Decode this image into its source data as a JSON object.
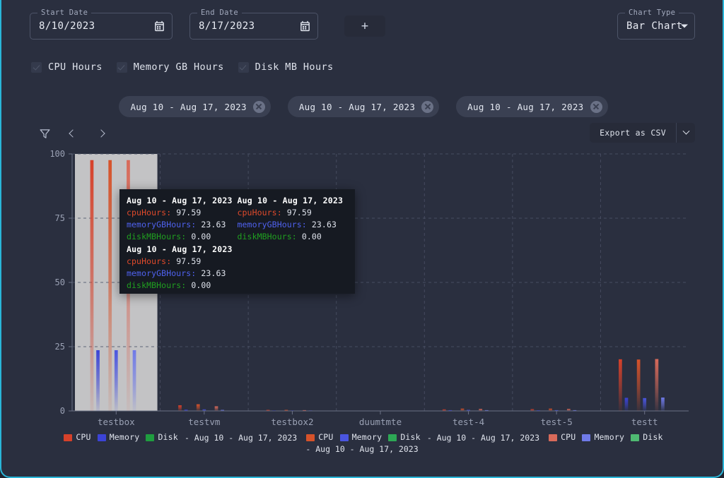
{
  "controls": {
    "start_date": {
      "label": "Start Date",
      "value": "8/10/2023",
      "icon": "calendar-icon"
    },
    "end_date": {
      "label": "End Date",
      "value": "8/17/2023",
      "icon": "calendar-icon"
    },
    "add_button": {
      "label": "+"
    },
    "chart_type": {
      "label": "Chart Type",
      "value": "Bar Chart",
      "options": [
        "Bar Chart"
      ]
    }
  },
  "metric_checkboxes": [
    {
      "label": "CPU Hours",
      "checked": true
    },
    {
      "label": "Memory GB Hours",
      "checked": true
    },
    {
      "label": "Disk MB Hours",
      "checked": true
    }
  ],
  "range_chips": [
    {
      "label": "Aug 10 - Aug 17, 2023"
    },
    {
      "label": "Aug 10 - Aug 17, 2023"
    },
    {
      "label": "Aug 10 - Aug 17, 2023"
    }
  ],
  "toolbar": {
    "filter_icon": "filter-funnel-icon",
    "prev_label": "‹",
    "next_label": "›",
    "export_label": "Export as CSV",
    "export_dropdown_icon": "chevron-down-icon"
  },
  "tooltip": {
    "columns": [
      {
        "groups": [
          {
            "title": "Aug 10 - Aug 17, 2023",
            "rows": [
              {
                "key": "cpuHours:",
                "value": "97.59",
                "color": "#e14a2b"
              },
              {
                "key": "memoryGBHours:",
                "value": "23.63",
                "color": "#4f62f0"
              },
              {
                "key": "diskMBHours:",
                "value": "0.00",
                "color": "#20a020"
              }
            ]
          },
          {
            "title": "Aug 10 - Aug 17, 2023",
            "rows": [
              {
                "key": "cpuHours:",
                "value": "97.59",
                "color": "#e14a2b"
              },
              {
                "key": "memoryGBHours:",
                "value": "23.63",
                "color": "#4f62f0"
              },
              {
                "key": "diskMBHours:",
                "value": "0.00",
                "color": "#20a020"
              }
            ]
          }
        ]
      },
      {
        "groups": [
          {
            "title": "Aug 10 - Aug 17, 2023",
            "rows": [
              {
                "key": "cpuHours:",
                "value": "97.59",
                "color": "#e14a2b"
              },
              {
                "key": "memoryGBHours:",
                "value": "23.63",
                "color": "#4f62f0"
              },
              {
                "key": "diskMBHours:",
                "value": "0.00",
                "color": "#20a020"
              }
            ]
          }
        ]
      }
    ]
  },
  "legend": [
    {
      "items": [
        {
          "label": "CPU",
          "color": "#d6412a"
        },
        {
          "label": "Memory",
          "color": "#3b43d6"
        },
        {
          "label": "Disk",
          "color": "#1f9d3f"
        }
      ],
      "suffix": "- Aug 10 - Aug 17, 2023"
    },
    {
      "items": [
        {
          "label": "CPU",
          "color": "#d6522a"
        },
        {
          "label": "Memory",
          "color": "#4a55e0"
        },
        {
          "label": "Disk",
          "color": "#2da855"
        }
      ],
      "suffix": "- Aug 10 - Aug 17, 2023"
    },
    {
      "items": [
        {
          "label": "CPU",
          "color": "#d86a5a"
        },
        {
          "label": "Memory",
          "color": "#6f7ae8"
        },
        {
          "label": "Disk",
          "color": "#4fba72"
        }
      ],
      "suffix": "- Aug 10 - Aug 17, 2023"
    }
  ],
  "chart_data": {
    "type": "bar",
    "title": "",
    "xlabel": "",
    "ylabel": "",
    "ylim": [
      0,
      100
    ],
    "yticks": [
      0,
      25,
      50,
      75,
      100
    ],
    "ytick_labels": [
      "0",
      "25",
      "50",
      "75",
      "100"
    ],
    "grid": true,
    "legend_position": "bottom",
    "categories": [
      "testbox",
      "testvm",
      "testbox2",
      "duumtmte",
      "test-4",
      "test-5",
      "testt"
    ],
    "highlighted_category": "testbox",
    "series": [
      {
        "name": "CPU - Aug 10 - Aug 17, 2023",
        "color": "#d6412a",
        "values": [
          97.59,
          2.2,
          0.4,
          0.0,
          0.6,
          0.7,
          20.1
        ]
      },
      {
        "name": "Memory - Aug 10 - Aug 17, 2023",
        "color": "#3b43d6",
        "values": [
          23.63,
          0.5,
          0.1,
          0.0,
          0.3,
          0.2,
          5.1
        ]
      },
      {
        "name": "Disk - Aug 10 - Aug 17, 2023",
        "color": "#1f9d3f",
        "values": [
          0.0,
          0.0,
          0.0,
          0.0,
          0.0,
          0.0,
          0.0
        ]
      },
      {
        "name": "CPU - Aug 10 - Aug 17, 2023",
        "color": "#d6522a",
        "values": [
          97.59,
          2.6,
          0.4,
          0.0,
          0.9,
          0.9,
          20.0
        ]
      },
      {
        "name": "Memory - Aug 10 - Aug 17, 2023",
        "color": "#4a55e0",
        "values": [
          23.63,
          0.6,
          0.1,
          0.0,
          0.4,
          0.3,
          5.0
        ]
      },
      {
        "name": "Disk - Aug 10 - Aug 17, 2023",
        "color": "#2da855",
        "values": [
          0.0,
          0.0,
          0.0,
          0.0,
          0.0,
          0.0,
          0.0
        ]
      },
      {
        "name": "CPU - Aug 10 - Aug 17, 2023",
        "color": "#d86a5a",
        "values": [
          97.59,
          1.8,
          0.3,
          0.0,
          0.8,
          0.8,
          20.2
        ]
      },
      {
        "name": "Memory - Aug 10 - Aug 17, 2023",
        "color": "#6f7ae8",
        "values": [
          23.63,
          0.4,
          0.1,
          0.0,
          0.3,
          0.3,
          5.2
        ]
      },
      {
        "name": "Disk - Aug 10 - Aug 17, 2023",
        "color": "#4fba72",
        "values": [
          0.0,
          0.0,
          0.0,
          0.0,
          0.0,
          0.0,
          0.0
        ]
      }
    ]
  }
}
